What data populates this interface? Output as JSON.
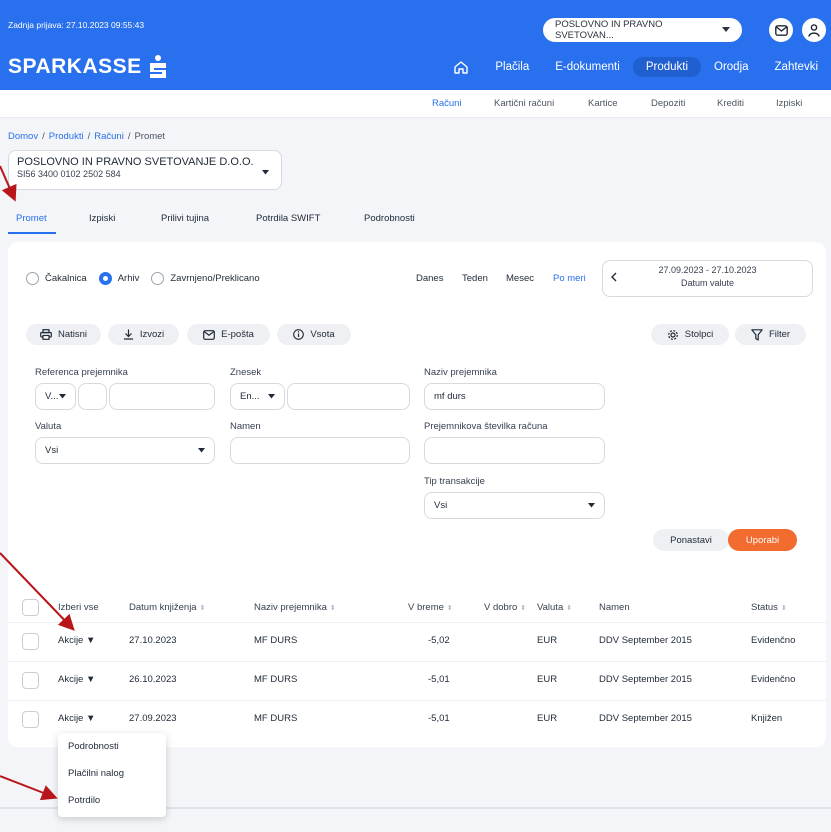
{
  "header": {
    "last_login": "Zadnja prijava: 27.10.2023 09:55:43",
    "company": "POSLOVNO IN PRAVNO SVETOVAN...",
    "logo": "SPARKASSE",
    "nav": [
      "Plačila",
      "E-dokumenti",
      "Produkti",
      "Orodja",
      "Zahtevki"
    ],
    "active_nav": "Produkti"
  },
  "subnav": [
    "Računi",
    "Kartični računi",
    "Kartice",
    "Depoziti",
    "Krediti",
    "Izpiski"
  ],
  "breadcrumb": {
    "home": "Domov",
    "products": "Produkti",
    "accounts": "Računi",
    "current": "Promet"
  },
  "account": {
    "name": "POSLOVNO IN PRAVNO SVETOVANJE D.O.O.",
    "iban": "SI56 3400 0102 2502 584"
  },
  "tabs": [
    "Promet",
    "Izpiski",
    "Prilivi tujina",
    "Potrdila SWIFT",
    "Podrobnosti"
  ],
  "filters": {
    "status_options": [
      "Čakalnica",
      "Arhiv",
      "Zavrnjeno/Preklicano"
    ],
    "selected_status": "Arhiv",
    "quick": [
      "Danes",
      "Teden",
      "Mesec",
      "Po meri"
    ],
    "date_range": "27.09.2023 - 27.10.2023",
    "date_type": "Datum valute"
  },
  "actions": {
    "print": "Natisni",
    "export": "Izvozi",
    "email": "E-pošta",
    "sum": "Vsota",
    "columns": "Stolpci",
    "filter": "Filter"
  },
  "form": {
    "ref_label": "Referenca prejemnika",
    "ref_select": "V...",
    "amount_label": "Znesek",
    "amount_select": "En...",
    "payee_label": "Naziv prejemnika",
    "payee_value": "mf durs",
    "currency_label": "Valuta",
    "currency_value": "Vsi",
    "purpose_label": "Namen",
    "payee_account_label": "Prejemnikova številka računa",
    "tx_type_label": "Tip transakcije",
    "tx_type_value": "Vsi",
    "reset": "Ponastavi",
    "apply": "Uporabi"
  },
  "table": {
    "headers": {
      "select_all": "Izberi vse",
      "booking_date": "Datum knjiženja",
      "payee": "Naziv prejemnika",
      "debit": "V breme",
      "credit": "V dobro",
      "currency": "Valuta",
      "purpose": "Namen",
      "status": "Status"
    },
    "rows": [
      {
        "actions": "Akcije",
        "date": "27.10.2023",
        "payee": "MF DURS",
        "debit": "-5,02",
        "currency": "EUR",
        "purpose": "DDV September 2015",
        "status": "Evidenčno"
      },
      {
        "actions": "Akcije",
        "date": "26.10.2023",
        "payee": "MF DURS",
        "debit": "-5,01",
        "currency": "EUR",
        "purpose": "DDV September 2015",
        "status": "Evidenčno"
      },
      {
        "actions": "Akcije",
        "date": "27.09.2023",
        "payee": "MF DURS",
        "debit": "-5,01",
        "currency": "EUR",
        "purpose": "DDV September 2015",
        "status": "Knjižen"
      }
    ]
  },
  "dropdown": [
    "Podrobnosti",
    "Plačilni nalog",
    "Potrdilo"
  ],
  "colors": {
    "brand": "#2870ed",
    "accent": "#f26b2f",
    "annotation": "#b8161b"
  }
}
